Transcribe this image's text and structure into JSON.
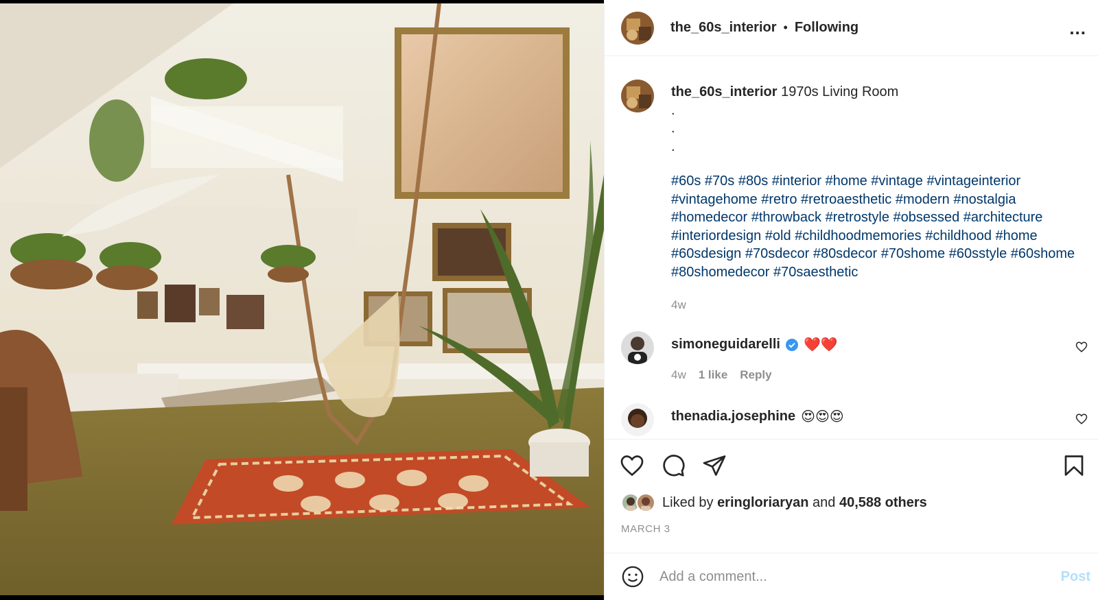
{
  "post": {
    "username": "the_60s_interior",
    "separator": "•",
    "follow_status": "Following",
    "more_icon_text": "...",
    "colors": {
      "link": "#00376b",
      "muted": "#8e8e8e",
      "post_disabled": "#b2dffc",
      "verified": "#3897f0"
    }
  },
  "caption": {
    "username": "the_60s_interior",
    "text": "1970s Living Room",
    "dots": [
      ".",
      ".",
      "."
    ],
    "hashtags": "#60s #70s #80s #interior #home #vintage #vintageinterior #vintagehome #retro #retroaesthetic #modern #nostalgia #homedecor #throwback #retrostyle #obsessed #architecture #interiordesign #old #childhoodmemories #childhood #home #60sdesign #70sdecor #80sdecor #70shome #60sstyle #60shome #80shomedecor #70saesthetic",
    "time": "4w"
  },
  "comments": [
    {
      "username": "simoneguidarelli",
      "verified": true,
      "text": "❤️❤️",
      "time": "4w",
      "likes": "1 like",
      "reply": "Reply"
    },
    {
      "username": "thenadia.josephine",
      "verified": false,
      "text": "😍😍😍"
    }
  ],
  "actions": {
    "icons": [
      "heart-icon",
      "comment-icon",
      "share-icon",
      "bookmark-icon"
    ],
    "liked_by_prefix": "Liked by",
    "liked_by_user": "eringloriaryan",
    "and": "and",
    "others": "40,588 others",
    "date": "MARCH 3"
  },
  "add_comment": {
    "placeholder": "Add a comment...",
    "post_label": "Post"
  }
}
